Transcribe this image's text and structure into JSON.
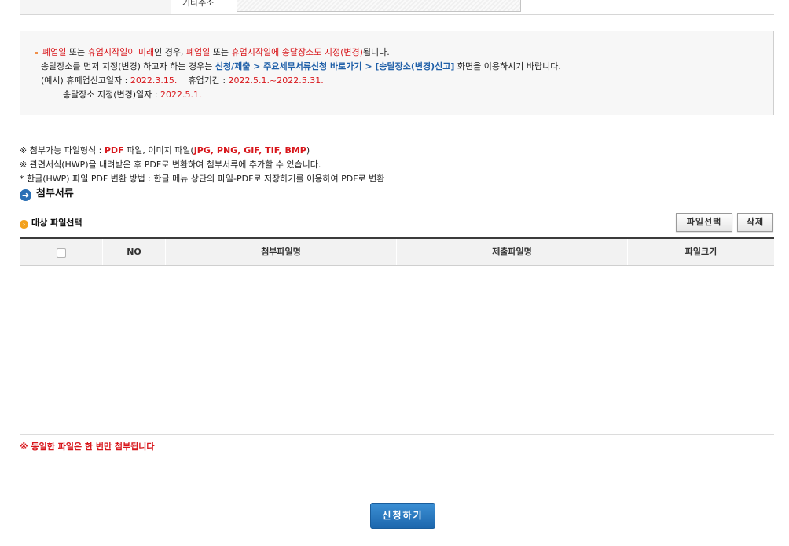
{
  "form": {
    "label": "기타주소"
  },
  "notice": {
    "l1": {
      "a": "폐업일",
      "b": " 또는 ",
      "c": "휴업시작일이 미래",
      "d": "인 경우, ",
      "e": "폐업일",
      "f": " 또는 ",
      "g": "휴업시작일에 송달장소도 지정(변경)",
      "h": "됩니다."
    },
    "l2": {
      "a": "송달장소를 먼저 지정(변경) 하고자 하는 경우는 ",
      "b": "신청/제출 > 주요세무서류신청 바로가기 > [송달장소(변경)신고]",
      "c": " 화면을 이용하시기 바랍니다."
    },
    "l3": {
      "a": "(예시) 휴폐업신고일자 : ",
      "b": "2022.3.15.",
      "c": "휴업기간 : ",
      "d": "2022.5.1.~2022.5.31."
    },
    "l4": {
      "a": "송달장소 지정(변경)일자 : ",
      "b": "2022.5.1."
    }
  },
  "notes": {
    "n1": {
      "a": "※ 첨부가능 파일형식 : ",
      "b": "PDF",
      "c": " 파일, 이미지 파일(",
      "d": "JPG, PNG, GIF, TIF, BMP",
      "e": ")"
    },
    "n2": "※ 관련서식(HWP)을 내려받은 후 PDF로 변환하여 첨부서류에 추가할 수 있습니다.",
    "n3": " * 한글(HWP) 파일 PDF 변환 방법 : 한글 메뉴 상단의 파일-PDF로 저장하기를 이용하여 PDF로 변환"
  },
  "section": {
    "title": "첨부서류",
    "sub_title": "대상 파일선택"
  },
  "buttons": {
    "select_file": "파일선택",
    "delete": "삭제",
    "submit": "신청하기"
  },
  "table": {
    "headers": [
      "NO",
      "첨부파일명",
      "제출파일명",
      "파일크기"
    ]
  },
  "warning": "※ 동일한 파일은 한 번만 첨부됩니다",
  "colors": {
    "red": "#d8161b",
    "blue": "#1f5fa8",
    "submit": "#2a7bc4"
  }
}
